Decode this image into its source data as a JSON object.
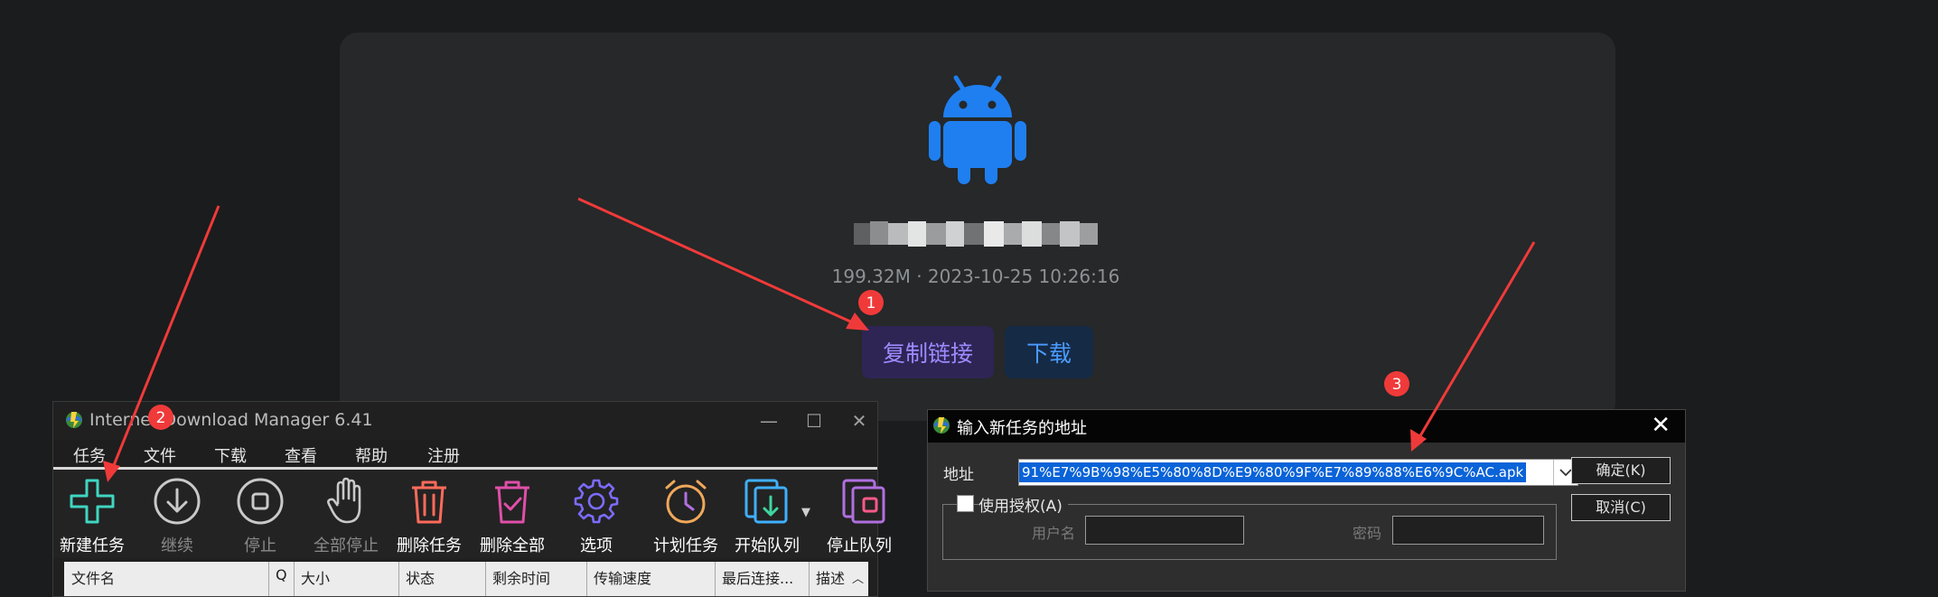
{
  "card": {
    "file_meta": "199.32M · 2023-10-25 10:26:16",
    "copy_link_label": "复制链接",
    "download_label": "下载"
  },
  "idm": {
    "title": "Internet Download Manager 6.41",
    "menu": [
      "任务",
      "文件",
      "下载",
      "查看",
      "帮助",
      "注册"
    ],
    "toolbar": [
      {
        "label": "新建任务",
        "icon": "plus-icon",
        "enabled": true
      },
      {
        "label": "继续",
        "icon": "download-arrow-icon",
        "enabled": false
      },
      {
        "label": "停止",
        "icon": "stop-icon",
        "enabled": false
      },
      {
        "label": "全部停止",
        "icon": "hand-icon",
        "enabled": false
      },
      {
        "label": "删除任务",
        "icon": "trash-icon",
        "enabled": true
      },
      {
        "label": "删除全部",
        "icon": "trash-check-icon",
        "enabled": true
      },
      {
        "label": "选项",
        "icon": "gear-icon",
        "enabled": true
      },
      {
        "label": "计划任务",
        "icon": "alarm-clock-icon",
        "enabled": true
      },
      {
        "label": "开始队列",
        "icon": "queue-start-icon",
        "enabled": true
      },
      {
        "label": "停止队列",
        "icon": "queue-stop-icon",
        "enabled": true
      }
    ],
    "table_columns": [
      "文件名",
      "Q",
      "大小",
      "状态",
      "剩余时间",
      "传输速度",
      "最后连接...",
      "描述"
    ]
  },
  "dialog": {
    "title": "输入新任务的地址",
    "address_label": "地址",
    "address_value": "91%E7%9B%98%E5%80%8D%E9%80%9F%E7%89%88%E6%9C%AC.apk",
    "ok_label": "确定(K)",
    "cancel_label": "取消(C)",
    "use_auth_label": "使用授权(A)",
    "username_label": "用户名",
    "password_label": "密码"
  },
  "annotations": {
    "markers": [
      "1",
      "2",
      "3"
    ],
    "color": "#f03a3a"
  },
  "colors": {
    "android_green": "#1f7ff0",
    "copy_button_text": "#9d8bff",
    "download_button_text": "#4a9cff",
    "selection_blue": "#0a63d8"
  }
}
